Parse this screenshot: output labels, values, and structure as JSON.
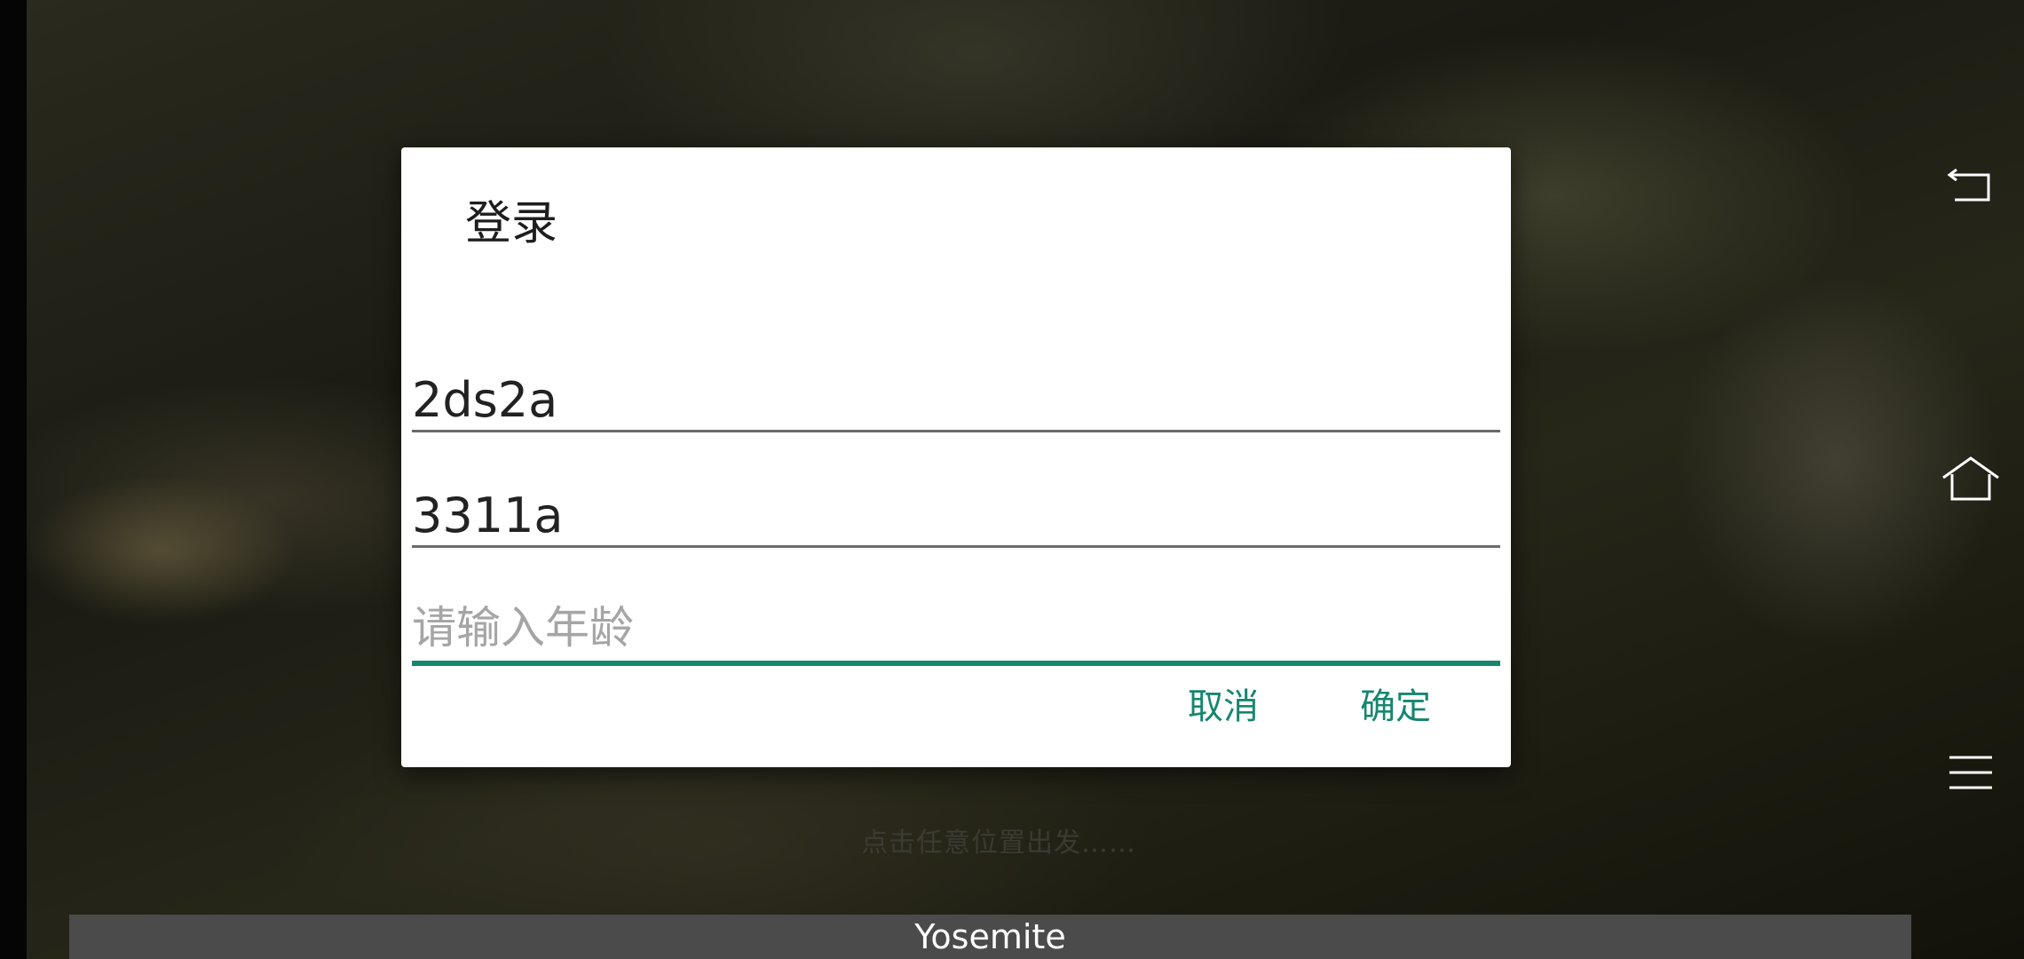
{
  "dialog": {
    "title": "登录",
    "fields": [
      {
        "value": "2ds2a"
      },
      {
        "value": "3311a"
      },
      {
        "value": "",
        "placeholder": "请输入年龄"
      }
    ],
    "cancel_label": "取消",
    "confirm_label": "确定"
  },
  "background": {
    "hint_text": "点击任意位置出发……"
  },
  "footer": {
    "label": "Yosemite"
  },
  "navigation": {
    "icons": [
      "back-icon",
      "home-icon",
      "menu-icon"
    ]
  },
  "colors": {
    "accent": "#17866f",
    "dialog_bg": "#ffffff",
    "footer_bg": "#4b4b4b"
  }
}
